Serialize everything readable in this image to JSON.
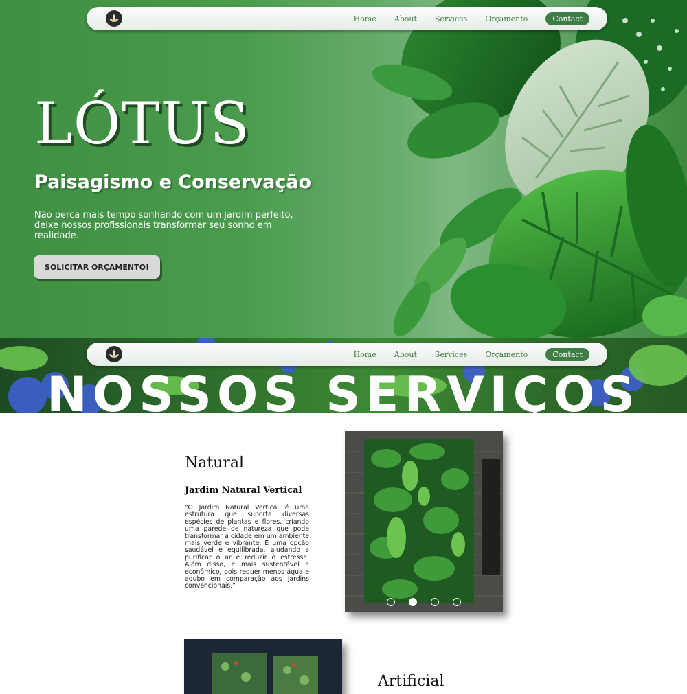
{
  "nav": {
    "logo_icon": "lotus-logo-icon",
    "links": [
      "Home",
      "About",
      "Services",
      "Orçamento"
    ],
    "contact": "Contact"
  },
  "hero": {
    "title": "LÓTUS",
    "subtitle": "Paisagismo e Conservação",
    "description": "Não perca mais tempo sonhando com um jardim perfeito, deixe nossos profissionais transformar seu sonho em realidade.",
    "cta": "SOLICITAR ORÇAMENTO!"
  },
  "services_banner": {
    "title": "NOSSOS SERVIÇOS"
  },
  "services": [
    {
      "heading": "Natural",
      "subheading": "Jardim Natural Vertical",
      "text": "“O Jardim Natural Vertical é uma estrutura que suporta diversas espécies de plantas e flores, criando uma parede de natureza que pode transformar a cidade em um ambiente mais verde e vibrante. É uma opção saudável e equilibrada, ajudando a purificar o ar e reduzir o estresse. Além disso, é mais sustentável e econômico, pois requer menos água e adubo em comparação aos jardins convencionais.”",
      "slides": 4,
      "active_slide": 2
    },
    {
      "heading": "Artificial"
    }
  ],
  "colors": {
    "brand_green": "#3f7d46",
    "hero_green": "#4a9b4e",
    "cta_bg": "#d9d9d9"
  }
}
